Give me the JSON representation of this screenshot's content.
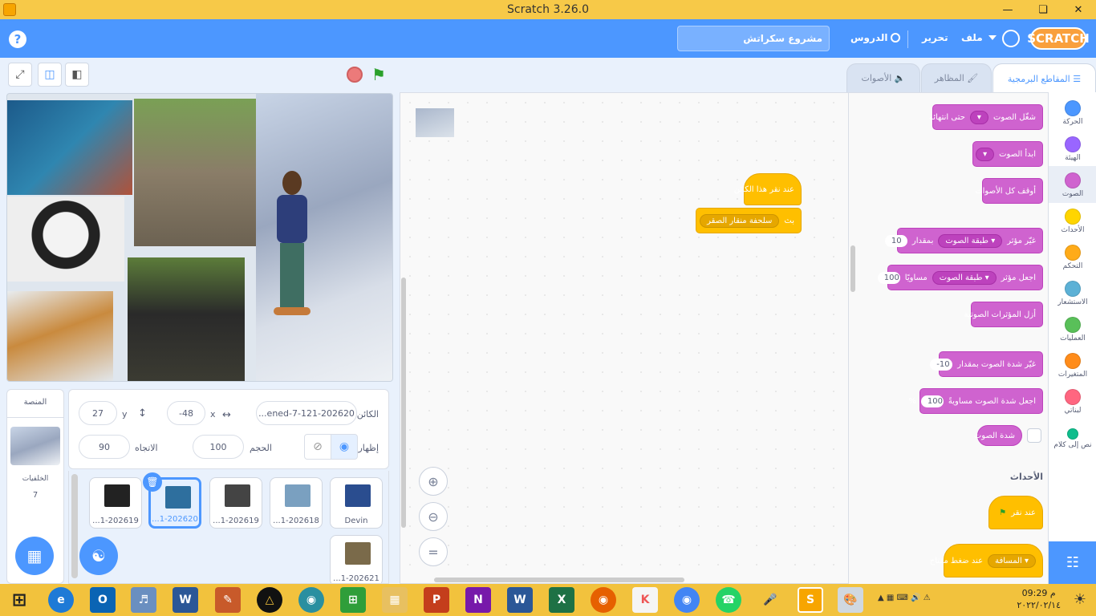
{
  "window": {
    "title": "Scratch 3.26.0"
  },
  "menubar": {
    "logo": "SCRATCH",
    "file": "ملف",
    "edit": "تحرير",
    "tutorials": "الدروس",
    "project_title": "مشروع سكراتش"
  },
  "tabs": {
    "code": "المقاطع البرمجية",
    "costumes": "المظاهر",
    "sounds": "الأصوات"
  },
  "sprite_info": {
    "sprite_label": "الكائن",
    "sprite_name": "...ened-7-121-202620",
    "x_label": "x",
    "x_value": "-48",
    "y_label": "y",
    "y_value": "27",
    "show_label": "إظهار",
    "size_label": "الحجم",
    "size_value": "100",
    "direction_label": "الاتجاه",
    "direction_value": "90"
  },
  "sprites": [
    {
      "name": "Devin",
      "color": "#2a4d8f"
    },
    {
      "name": "...1-202618",
      "color": "#7aa0c0"
    },
    {
      "name": "...1-202619",
      "color": "#444"
    },
    {
      "name": "...1-202620",
      "color": "#2e6f9e",
      "selected": true
    },
    {
      "name": "...1-202619",
      "color": "#222"
    },
    {
      "name": "...1-202621",
      "color": "#7a6a4a"
    }
  ],
  "stage_panel": {
    "title": "المنصة",
    "backdrops_label": "الخلفيات",
    "backdrops_count": "7"
  },
  "categories": [
    {
      "label": "الحركة",
      "color": "#4c97ff"
    },
    {
      "label": "الهيئة",
      "color": "#9966ff"
    },
    {
      "label": "الصوت",
      "color": "#cf63cf",
      "selected": true
    },
    {
      "label": "الأحداث",
      "color": "#ffd500"
    },
    {
      "label": "التحكم",
      "color": "#ffab19"
    },
    {
      "label": "الاستشعار",
      "color": "#5cb1d6"
    },
    {
      "label": "العمليات",
      "color": "#59c059"
    },
    {
      "label": "المتغيرات",
      "color": "#ff8c1a"
    },
    {
      "label": "لبناتي",
      "color": "#ff6680"
    },
    {
      "label": "نص إلى كلام",
      "color": "#0fbd8c"
    }
  ],
  "palette": {
    "play_until_done": "شغّل الصوت",
    "play_until_done_tail": "حتى انتهائه",
    "start_sound": "ابدأ الصوت",
    "stop_all": "أوقف كل الأصوات",
    "change_effect": "غيّر مؤثر",
    "effect_pitch": "طبقة الصوت",
    "by": "بمقدار",
    "change_effect_value": "10",
    "set_effect": "اجعل مؤثر",
    "equal": "مساويًا",
    "set_effect_value": "100",
    "clear_effects": "أزل المؤثرات الصوتية",
    "change_volume": "غيّر شدة الصوت بمقدار",
    "change_volume_value": "-10",
    "set_volume": "اجعل شدة الصوت مساويةً",
    "set_volume_value": "100",
    "percent": "%",
    "volume_reporter": "شدة الصوت",
    "events_heading": "الأحداث",
    "when_flag": "عند نقر",
    "when_key": "عند ضغط مفتاح",
    "key_space": "المسافة"
  },
  "workspace": {
    "hat_label": "عند نقر هذا الكائن",
    "broadcast": "بث",
    "broadcast_msg": "سلحفة منقار الصقر"
  },
  "clock": {
    "time": "09:29 م",
    "date": "٢٠٢٢/٠٢/١٤"
  }
}
